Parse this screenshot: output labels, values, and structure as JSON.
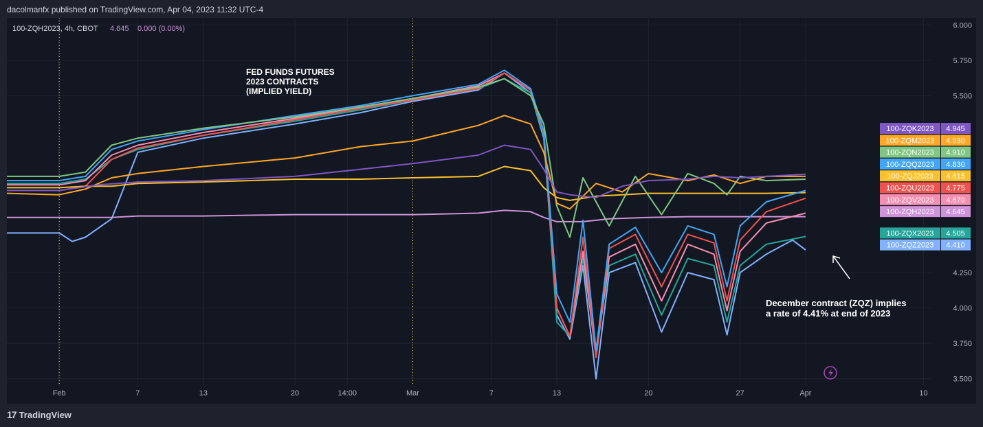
{
  "header": "dacolmanfx published on TradingView.com, Apr 04, 2023 11:32 UTC-4",
  "footer": {
    "logo_text": "17",
    "brand": "TradingView"
  },
  "colors": {
    "background": "#131722",
    "page": "#1e222d",
    "grid": "#1f2430",
    "text": "#b2b5be"
  },
  "chart_data": {
    "type": "line",
    "legend_top": {
      "symbol": "100-ZQH2023, 4h, CBOT",
      "value": "4.645",
      "change": "0.000 (0.00%)"
    },
    "title_lines": [
      "FED FUNDS FUTURES",
      "2023 CONTRACTS",
      "(IMPLIED YIELD)"
    ],
    "annotation_lines": [
      "December contract (ZQZ) implies",
      "a rate of 4.41% at end of 2023"
    ],
    "y_ticks": [
      "6.000",
      "5.750",
      "5.500",
      "4.250",
      "4.000",
      "3.750",
      "3.500"
    ],
    "y_tick_values": [
      6.0,
      5.75,
      5.5,
      4.25,
      4.0,
      3.75,
      3.5
    ],
    "ylim": [
      3.45,
      6.05
    ],
    "xlim": [
      0,
      63
    ],
    "x_ticks": [
      {
        "label": "Feb",
        "x": 4
      },
      {
        "label": "7",
        "x": 10
      },
      {
        "label": "13",
        "x": 15
      },
      {
        "label": "20",
        "x": 22
      },
      {
        "label": "14:00",
        "x": 26
      },
      {
        "label": "Mar",
        "x": 31
      },
      {
        "label": "7",
        "x": 37
      },
      {
        "label": "13",
        "x": 42
      },
      {
        "label": "20",
        "x": 49
      },
      {
        "label": "27",
        "x": 56
      },
      {
        "label": "Apr",
        "x": 61
      },
      {
        "label": "10",
        "x": 70
      }
    ],
    "x_tick_scale": [
      0,
      63
    ],
    "series": [
      {
        "name": "100-ZQK2023",
        "value": "4.945",
        "color": "#7e57c2",
        "points": [
          [
            0,
            4.83
          ],
          [
            4,
            4.83
          ],
          [
            7,
            4.87
          ],
          [
            10,
            4.89
          ],
          [
            15,
            4.9
          ],
          [
            22,
            4.93
          ],
          [
            27,
            4.98
          ],
          [
            31,
            5.02
          ],
          [
            36,
            5.08
          ],
          [
            38,
            5.15
          ],
          [
            40,
            5.12
          ],
          [
            41,
            4.98
          ],
          [
            42,
            4.82
          ],
          [
            43,
            4.8
          ],
          [
            45,
            4.78
          ],
          [
            47,
            4.86
          ],
          [
            49,
            4.9
          ],
          [
            52,
            4.91
          ],
          [
            54,
            4.93
          ],
          [
            56,
            4.92
          ],
          [
            58,
            4.93
          ],
          [
            61,
            4.945
          ]
        ]
      },
      {
        "name": "100-ZQM2023",
        "value": "4.930",
        "color": "#ffa726",
        "points": [
          [
            0,
            4.81
          ],
          [
            4,
            4.8
          ],
          [
            6,
            4.84
          ],
          [
            8,
            4.92
          ],
          [
            10,
            4.95
          ],
          [
            15,
            5.0
          ],
          [
            22,
            5.06
          ],
          [
            27,
            5.14
          ],
          [
            31,
            5.18
          ],
          [
            36,
            5.29
          ],
          [
            38,
            5.36
          ],
          [
            40,
            5.3
          ],
          [
            41,
            5.1
          ],
          [
            42,
            4.74
          ],
          [
            43,
            4.7
          ],
          [
            45,
            4.88
          ],
          [
            47,
            4.82
          ],
          [
            49,
            4.95
          ],
          [
            52,
            4.9
          ],
          [
            54,
            4.94
          ],
          [
            56,
            4.88
          ],
          [
            58,
            4.93
          ],
          [
            61,
            4.93
          ]
        ]
      },
      {
        "name": "100-ZQN2023",
        "value": "4.910",
        "color": "#81c784",
        "points": [
          [
            0,
            4.93
          ],
          [
            4,
            4.93
          ],
          [
            6,
            4.96
          ],
          [
            8,
            5.15
          ],
          [
            10,
            5.2
          ],
          [
            15,
            5.27
          ],
          [
            22,
            5.35
          ],
          [
            27,
            5.42
          ],
          [
            31,
            5.48
          ],
          [
            36,
            5.56
          ],
          [
            38,
            5.62
          ],
          [
            40,
            5.5
          ],
          [
            41,
            5.3
          ],
          [
            42,
            4.72
          ],
          [
            43,
            4.5
          ],
          [
            44,
            4.92
          ],
          [
            46,
            4.58
          ],
          [
            48,
            4.93
          ],
          [
            50,
            4.66
          ],
          [
            52,
            4.95
          ],
          [
            54,
            4.88
          ],
          [
            55,
            4.8
          ],
          [
            56,
            4.93
          ],
          [
            58,
            4.9
          ],
          [
            61,
            4.91
          ]
        ]
      },
      {
        "name": "100-ZQQ2023",
        "value": "4.830",
        "color": "#42a5f5",
        "points": [
          [
            0,
            4.9
          ],
          [
            4,
            4.9
          ],
          [
            6,
            4.93
          ],
          [
            8,
            5.12
          ],
          [
            10,
            5.18
          ],
          [
            15,
            5.26
          ],
          [
            22,
            5.36
          ],
          [
            27,
            5.43
          ],
          [
            31,
            5.5
          ],
          [
            36,
            5.58
          ],
          [
            38,
            5.68
          ],
          [
            40,
            5.55
          ],
          [
            41,
            5.25
          ],
          [
            42,
            4.1
          ],
          [
            43,
            3.9
          ],
          [
            44,
            4.62
          ],
          [
            45,
            3.7
          ],
          [
            46,
            4.45
          ],
          [
            48,
            4.57
          ],
          [
            50,
            4.25
          ],
          [
            52,
            4.58
          ],
          [
            54,
            4.52
          ],
          [
            55,
            4.15
          ],
          [
            56,
            4.58
          ],
          [
            58,
            4.75
          ],
          [
            61,
            4.83
          ]
        ]
      },
      {
        "name": "100-ZQJ2023",
        "value": "4.815",
        "color": "#fbc02d",
        "points": [
          [
            0,
            4.85
          ],
          [
            4,
            4.85
          ],
          [
            6,
            4.86
          ],
          [
            8,
            4.86
          ],
          [
            10,
            4.88
          ],
          [
            15,
            4.89
          ],
          [
            22,
            4.91
          ],
          [
            27,
            4.91
          ],
          [
            31,
            4.92
          ],
          [
            36,
            4.93
          ],
          [
            38,
            5.0
          ],
          [
            40,
            4.97
          ],
          [
            41,
            4.85
          ],
          [
            42,
            4.78
          ],
          [
            43,
            4.76
          ],
          [
            45,
            4.79
          ],
          [
            47,
            4.8
          ],
          [
            49,
            4.81
          ],
          [
            52,
            4.81
          ],
          [
            55,
            4.81
          ],
          [
            58,
            4.81
          ],
          [
            61,
            4.815
          ]
        ]
      },
      {
        "name": "100-ZQU2023",
        "value": "4.775",
        "color": "#ef5350",
        "points": [
          [
            0,
            4.83
          ],
          [
            4,
            4.83
          ],
          [
            6,
            4.86
          ],
          [
            8,
            5.05
          ],
          [
            10,
            5.13
          ],
          [
            15,
            5.22
          ],
          [
            22,
            5.33
          ],
          [
            27,
            5.41
          ],
          [
            31,
            5.47
          ],
          [
            36,
            5.55
          ],
          [
            38,
            5.66
          ],
          [
            40,
            5.54
          ],
          [
            41,
            5.24
          ],
          [
            42,
            4.0
          ],
          [
            43,
            3.8
          ],
          [
            44,
            4.5
          ],
          [
            45,
            3.65
          ],
          [
            46,
            4.42
          ],
          [
            48,
            4.52
          ],
          [
            50,
            4.15
          ],
          [
            52,
            4.52
          ],
          [
            54,
            4.46
          ],
          [
            55,
            4.05
          ],
          [
            56,
            4.48
          ],
          [
            58,
            4.68
          ],
          [
            61,
            4.775
          ]
        ]
      },
      {
        "name": "100-ZQV2023",
        "value": "4.670",
        "color": "#f48fb1",
        "points": [
          [
            0,
            4.87
          ],
          [
            4,
            4.87
          ],
          [
            6,
            4.9
          ],
          [
            8,
            5.08
          ],
          [
            10,
            5.15
          ],
          [
            15,
            5.24
          ],
          [
            22,
            5.34
          ],
          [
            27,
            5.42
          ],
          [
            31,
            5.48
          ],
          [
            36,
            5.57
          ],
          [
            38,
            5.66
          ],
          [
            40,
            5.54
          ],
          [
            41,
            5.24
          ],
          [
            42,
            4.0
          ],
          [
            43,
            3.8
          ],
          [
            44,
            4.4
          ],
          [
            45,
            3.65
          ],
          [
            46,
            4.36
          ],
          [
            48,
            4.45
          ],
          [
            50,
            4.05
          ],
          [
            52,
            4.45
          ],
          [
            54,
            4.38
          ],
          [
            55,
            3.98
          ],
          [
            56,
            4.4
          ],
          [
            58,
            4.6
          ],
          [
            61,
            4.67
          ]
        ]
      },
      {
        "name": "100-ZQH2023",
        "value": "4.645",
        "color": "#ce93d8",
        "points": [
          [
            0,
            4.64
          ],
          [
            4,
            4.64
          ],
          [
            8,
            4.64
          ],
          [
            10,
            4.65
          ],
          [
            15,
            4.65
          ],
          [
            22,
            4.66
          ],
          [
            27,
            4.66
          ],
          [
            31,
            4.66
          ],
          [
            36,
            4.67
          ],
          [
            38,
            4.69
          ],
          [
            40,
            4.68
          ],
          [
            41,
            4.64
          ],
          [
            42,
            4.61
          ],
          [
            44,
            4.61
          ],
          [
            46,
            4.63
          ],
          [
            49,
            4.64
          ],
          [
            52,
            4.645
          ],
          [
            55,
            4.645
          ],
          [
            58,
            4.645
          ],
          [
            61,
            4.645
          ]
        ]
      },
      {
        "name": "100-ZQX2023",
        "value": "4.505",
        "color": "#26a69a",
        "points": [
          [
            0,
            4.88
          ],
          [
            4,
            4.88
          ],
          [
            6,
            4.91
          ],
          [
            8,
            5.05
          ],
          [
            10,
            5.12
          ],
          [
            15,
            5.22
          ],
          [
            22,
            5.32
          ],
          [
            27,
            5.4
          ],
          [
            31,
            5.47
          ],
          [
            36,
            5.55
          ],
          [
            38,
            5.62
          ],
          [
            40,
            5.52
          ],
          [
            41,
            5.22
          ],
          [
            42,
            3.9
          ],
          [
            43,
            3.8
          ],
          [
            44,
            4.35
          ],
          [
            45,
            3.7
          ],
          [
            46,
            4.3
          ],
          [
            48,
            4.38
          ],
          [
            50,
            3.95
          ],
          [
            52,
            4.35
          ],
          [
            54,
            4.3
          ],
          [
            55,
            3.9
          ],
          [
            56,
            4.3
          ],
          [
            58,
            4.45
          ],
          [
            61,
            4.505
          ]
        ]
      },
      {
        "name": "100-ZQZ2023",
        "value": "4.410",
        "color": "#82b1ff",
        "points": [
          [
            0,
            4.53
          ],
          [
            4,
            4.53
          ],
          [
            5,
            4.47
          ],
          [
            6,
            4.5
          ],
          [
            8,
            4.63
          ],
          [
            10,
            5.1
          ],
          [
            15,
            5.2
          ],
          [
            22,
            5.3
          ],
          [
            27,
            5.38
          ],
          [
            31,
            5.46
          ],
          [
            36,
            5.54
          ],
          [
            38,
            5.66
          ],
          [
            40,
            5.52
          ],
          [
            41,
            5.2
          ],
          [
            42,
            3.95
          ],
          [
            43,
            3.78
          ],
          [
            44,
            4.3
          ],
          [
            45,
            3.5
          ],
          [
            46,
            4.25
          ],
          [
            48,
            4.32
          ],
          [
            50,
            3.83
          ],
          [
            52,
            4.25
          ],
          [
            54,
            4.2
          ],
          [
            55,
            3.81
          ],
          [
            56,
            4.25
          ],
          [
            58,
            4.38
          ],
          [
            60,
            4.48
          ],
          [
            61,
            4.41
          ]
        ]
      }
    ]
  }
}
